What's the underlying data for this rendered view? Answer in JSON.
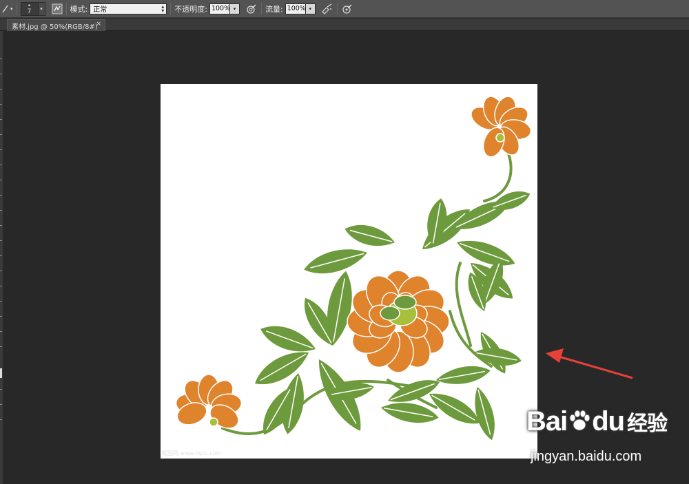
{
  "options_bar": {
    "brush_size": "7",
    "mode_label": "模式:",
    "mode_value": "正常",
    "opacity_label": "不透明度:",
    "opacity_value": "100%",
    "flow_label": "流量:",
    "flow_value": "100%",
    "icons": [
      "brush-tool-icon",
      "brush-panel-toggle-icon",
      "airbrush-icon",
      "pressure-opacity-icon",
      "pressure-size-icon"
    ]
  },
  "tab": {
    "title": "素材.jpg @ 50%(RGB/8#)",
    "close": "×"
  },
  "canvas": {
    "watermark": "昵图网 www.nipic.com",
    "colors": {
      "petal": "#E0832D",
      "leaf": "#6E9A3E",
      "stem": "#6E9A3E",
      "center": "#A8BF3C",
      "background": "#FFFFFF"
    }
  },
  "annotation": {
    "color": "#E8403A",
    "kind": "red-arrow"
  },
  "baidu_watermark": {
    "logo_text": "Bai",
    "logo_du": "du",
    "jingyan": "经验",
    "url": "jingyan.baidu.com"
  }
}
